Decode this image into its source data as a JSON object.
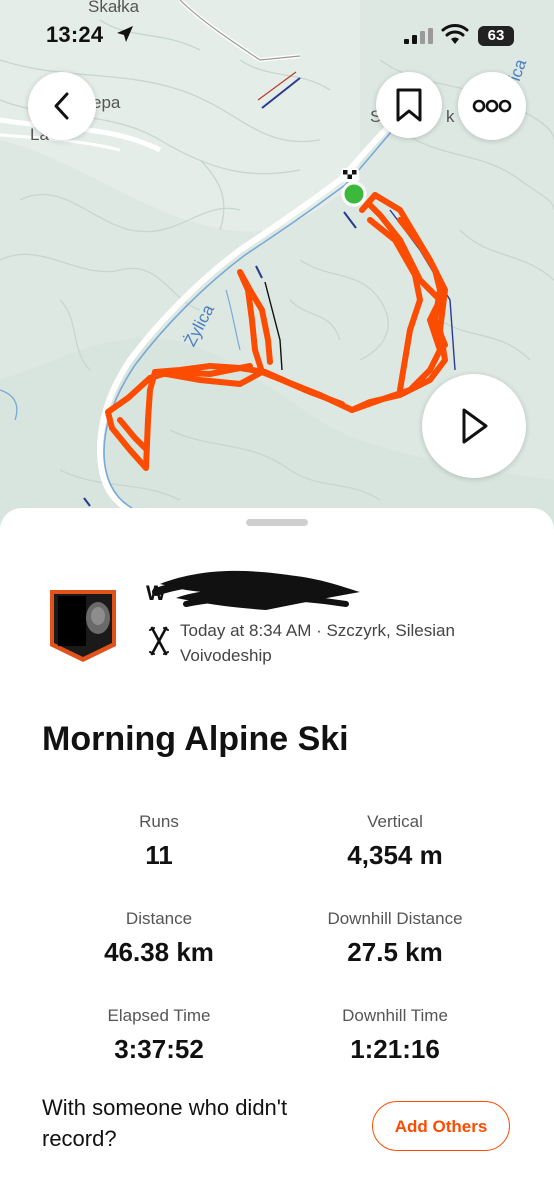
{
  "status_bar": {
    "time": "13:24",
    "battery": "63",
    "icons": [
      "location-arrow-icon",
      "cellular-signal-icon",
      "wifi-icon",
      "battery-icon"
    ]
  },
  "map": {
    "labels": {
      "top": "Skałka",
      "left_a": "epa",
      "left_b": "La",
      "river": "Żylica",
      "right_a": "S",
      "right_b": "k",
      "right_c": "ica"
    },
    "route_color": "#fc4c02",
    "start_marker_color": "#3cb93c",
    "buttons": {
      "back": "back-icon",
      "bookmark": "bookmark-icon",
      "more": "more-icon",
      "play": "play-icon"
    }
  },
  "activity": {
    "athlete_name": "W",
    "sport_icon": "alpine-ski-icon",
    "meta": "Today at 8:34 AM · Szczyrk, Silesian Voivodeship",
    "title": "Morning Alpine Ski",
    "stats": [
      {
        "label": "Runs",
        "value": "11"
      },
      {
        "label": "Vertical",
        "value": "4,354 m"
      },
      {
        "label": "Distance",
        "value": "46.38 km"
      },
      {
        "label": "Downhill Distance",
        "value": "27.5 km"
      },
      {
        "label": "Elapsed Time",
        "value": "3:37:52"
      },
      {
        "label": "Downhill Time",
        "value": "1:21:16"
      }
    ]
  },
  "others": {
    "prompt": "With someone who didn't record?",
    "button_label": "Add Others"
  },
  "colors": {
    "accent": "#fc4c02"
  }
}
